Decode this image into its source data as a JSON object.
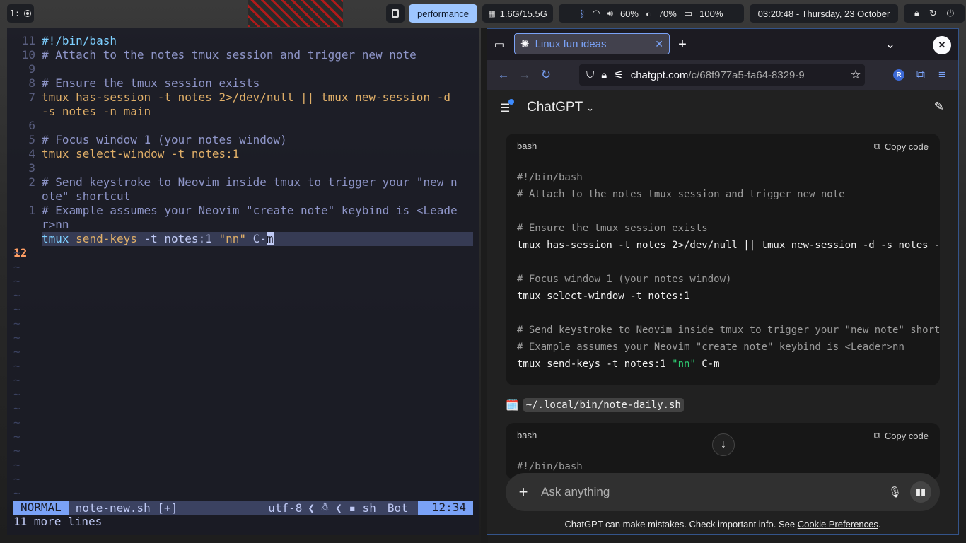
{
  "topbar": {
    "workspace": "1:",
    "profile_label": "performance",
    "memory": "1.6G/15.5G",
    "volume": "60%",
    "brightness": "70%",
    "battery": "100%",
    "clock": "03:20:48 - Thursday, 23 October"
  },
  "editor": {
    "lines": [
      {
        "num": "11",
        "text": "#!/bin/bash",
        "kind": "shebang"
      },
      {
        "num": "10",
        "text": "# Attach to the notes tmux session and trigger new note",
        "kind": "comment"
      },
      {
        "num": "9",
        "text": "",
        "kind": "plain"
      },
      {
        "num": "8",
        "text": "# Ensure the tmux session exists",
        "kind": "comment"
      },
      {
        "num": "7",
        "text": "tmux has-session -t notes 2>/dev/null || tmux new-session -d",
        "kind": "code"
      },
      {
        "num": "",
        "text": "-s notes -n main",
        "kind": "code-cont"
      },
      {
        "num": "6",
        "text": "",
        "kind": "plain"
      },
      {
        "num": "5",
        "text": "# Focus window 1 (your notes window)",
        "kind": "comment"
      },
      {
        "num": "4",
        "text": "tmux select-window -t notes:1",
        "kind": "code"
      },
      {
        "num": "3",
        "text": "",
        "kind": "plain"
      },
      {
        "num": "2",
        "text": "# Send keystroke to Neovim inside tmux to trigger your \"new n",
        "kind": "comment"
      },
      {
        "num": "",
        "text": "ote\" shortcut",
        "kind": "comment"
      },
      {
        "num": "1",
        "text": "# Example assumes your Neovim \"create note\" keybind is <Leade",
        "kind": "comment"
      },
      {
        "num": "",
        "text": "r>nn",
        "kind": "comment"
      }
    ],
    "current_line": {
      "num": "12",
      "before_cursor": "tmux send-keys -t notes:1 \"nn\" C-",
      "cursor_char": "m"
    },
    "tilde": "~",
    "status": {
      "mode": "NORMAL",
      "filename": "note-new.sh [+]",
      "encoding": "utf-8",
      "filetype": "sh",
      "scroll": "Bot",
      "position": "12:34"
    },
    "message": "11 more lines"
  },
  "browser": {
    "tab_title": "Linux fun ideas",
    "url_domain": "chatgpt.com",
    "url_path": "/c/68f977a5-fa64-8329-9",
    "profile_initial": "R",
    "app_title": "ChatGPT",
    "code_lang": "bash",
    "copy_label": "Copy code",
    "code_lines": [
      {
        "text": "#!/bin/bash",
        "kind": "cm"
      },
      {
        "text": "# Attach to the notes tmux session and trigger new note",
        "kind": "cm"
      },
      {
        "text": "",
        "kind": ""
      },
      {
        "text": "# Ensure the tmux session exists",
        "kind": "cm"
      },
      {
        "text": "tmux has-session -t notes 2>/dev/null || tmux new-session -d -s notes -n",
        "kind": ""
      },
      {
        "text": "",
        "kind": ""
      },
      {
        "text": "# Focus window 1 (your notes window)",
        "kind": "cm"
      },
      {
        "text": "tmux select-window -t notes:1",
        "kind": ""
      },
      {
        "text": "",
        "kind": ""
      },
      {
        "text": "# Send keystroke to Neovim inside tmux to trigger your \"new note\" shortc",
        "kind": "cm"
      },
      {
        "text": "# Example assumes your Neovim \"create note\" keybind is <Leader>nn",
        "kind": "cm"
      }
    ],
    "last_code_line": {
      "prefix": "tmux send-keys -t notes:1 ",
      "string": "\"nn\"",
      "suffix": " C-m"
    },
    "file_emoji": "🗓️",
    "file_path": "~/.local/bin/note-daily.sh",
    "code2_lang": "bash",
    "code2_first_line": "#!/bin/bash",
    "composer_placeholder": "Ask anything",
    "disclaimer_prefix": "ChatGPT can make mistakes. Check important info. See ",
    "disclaimer_link": "Cookie Preferences",
    "disclaimer_suffix": "."
  }
}
